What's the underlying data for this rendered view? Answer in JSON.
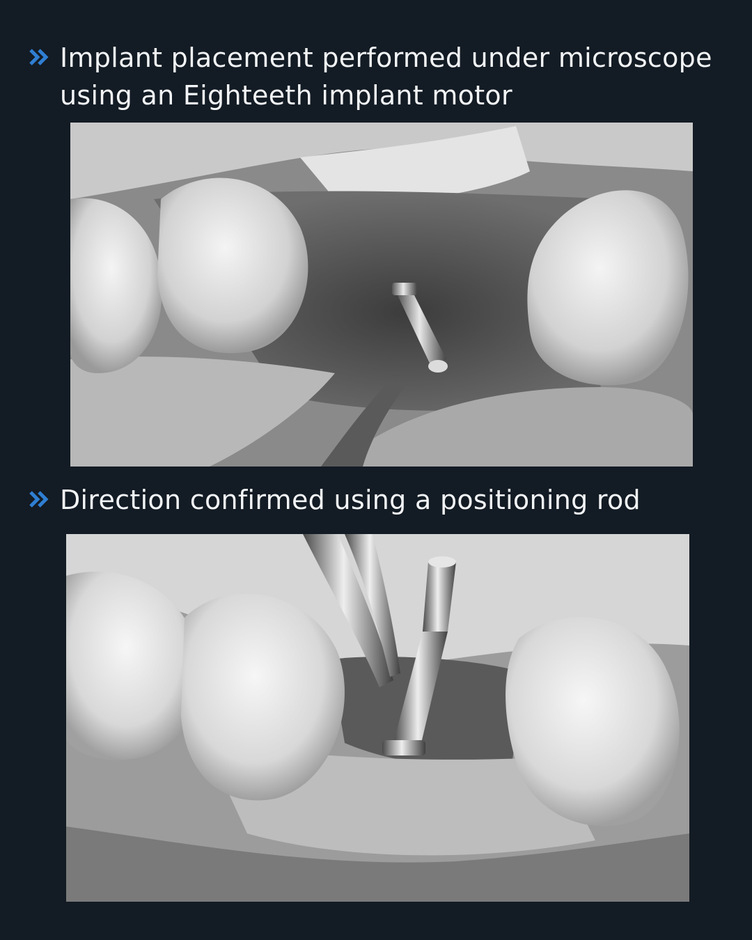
{
  "accent_color": "#2f7fd3",
  "sections": [
    {
      "icon": "double-chevron-right-icon",
      "caption": "Implant placement performed under microscope\nusing an Eighteeth implant motor"
    },
    {
      "icon": "double-chevron-right-icon",
      "caption": "Direction confirmed using a positioning rod"
    }
  ]
}
